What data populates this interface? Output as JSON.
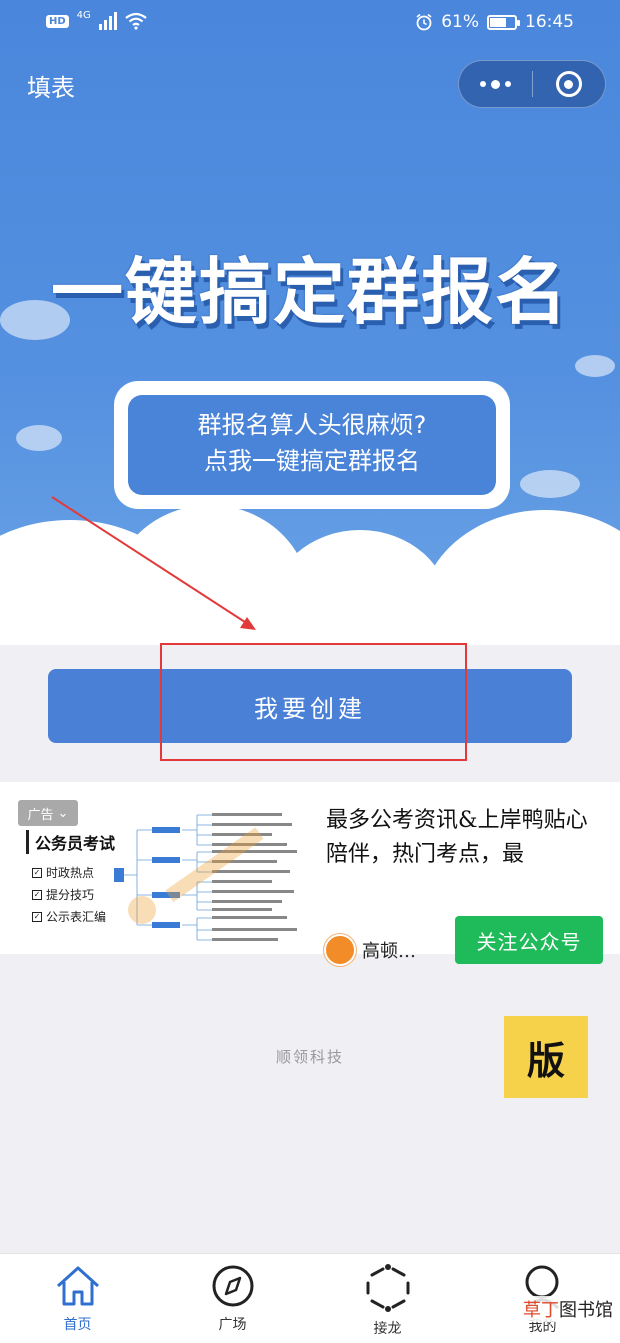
{
  "status_bar": {
    "hd": "HD",
    "network": "4G",
    "battery_percent": "61%",
    "battery_level": 0.61,
    "time": "16:45"
  },
  "nav": {
    "title": "填表"
  },
  "hero": {
    "headline": "一键搞定群报名",
    "bubble_line1": "群报名算人头很麻烦?",
    "bubble_line2": "点我一键搞定群报名"
  },
  "main": {
    "create_button": "我要创建"
  },
  "ad": {
    "tag": "广告",
    "left_title": "公务员考试",
    "left_items": [
      "时政热点",
      "提分技巧",
      "公示表汇编"
    ],
    "text": "最多公考资讯&上岸鸭贴心陪伴，热门考点，最",
    "brand": "高顿…",
    "follow_button": "关注公众号"
  },
  "footer": {
    "company": "顺领科技",
    "badge": "版"
  },
  "tabbar": {
    "items": [
      {
        "label": "首页",
        "icon": "home-icon"
      },
      {
        "label": "广场",
        "icon": "compass-icon"
      },
      {
        "label": "接龙",
        "icon": "hexagon-dots-icon"
      },
      {
        "label": "我的",
        "icon": "search-person-icon"
      }
    ]
  },
  "watermark": {
    "accent": "草丁",
    "rest": "图书馆"
  },
  "colors": {
    "brand_blue": "#4a80d6",
    "annotation_red": "#e23a3a",
    "follow_green": "#1fba5a"
  }
}
